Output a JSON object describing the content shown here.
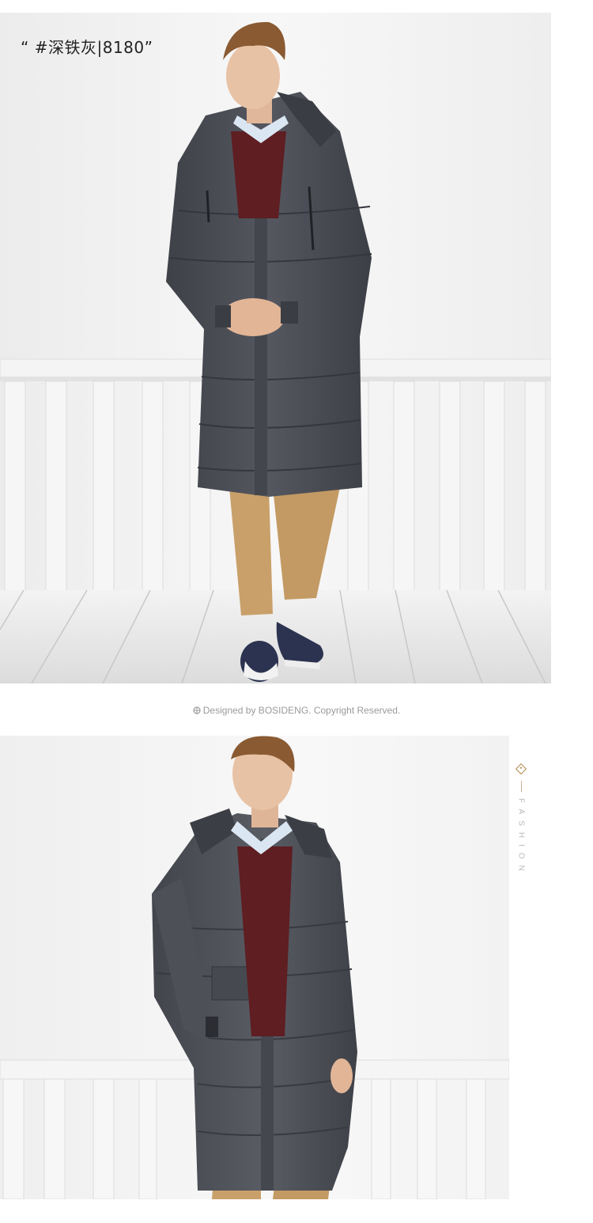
{
  "caption": {
    "color_label": "“ #深铁灰|8180”"
  },
  "footer": {
    "credit_text": "Designed by BOSIDENG. Copyright Reserved."
  },
  "side_tag": {
    "word": "FASHION"
  },
  "colors": {
    "coat": "#4b4d54",
    "sweater": "#5e1e22",
    "trousers": "#c9a06a",
    "shoes": "#2b3350",
    "railing": "#f1f1f1",
    "accent": "#b28a52"
  },
  "icons": [
    "logo-icon",
    "diamond-icon"
  ]
}
